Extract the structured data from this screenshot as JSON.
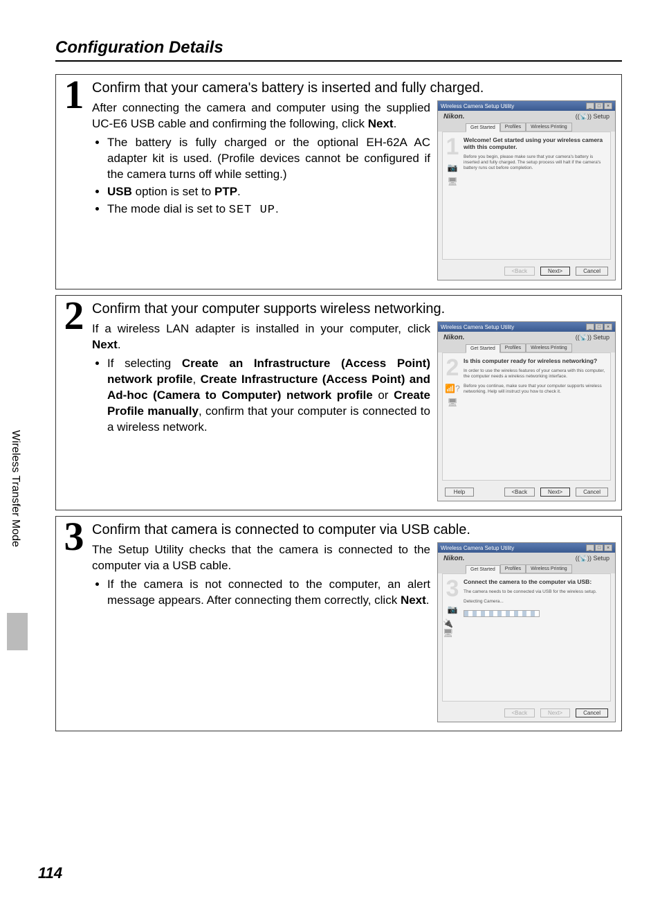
{
  "sectionTitle": "Configuration Details",
  "sideTab": "Wireless Transfer Mode",
  "pageNumber": "114",
  "steps": [
    {
      "num": "1",
      "title": "Confirm that your camera's battery is inserted and fully charged.",
      "intro_a": "After connecting the camera and computer using the supplied UC-E6 USB cable and confirming the following, click ",
      "intro_next": "Next",
      "intro_b": ".",
      "b1": "The battery is fully charged or the optional EH-62A AC adapter kit is used. (Profile devices cannot be configured if the camera turns off while setting.)",
      "b2_a": "USB",
      "b2_b": " option is set to ",
      "b2_c": "PTP",
      "b2_d": ".",
      "b3_a": "The mode dial is set to ",
      "b3_b": "SET UP",
      "b3_c": "."
    },
    {
      "num": "2",
      "title": "Confirm that your computer supports wireless networking.",
      "intro_a": "If a wireless LAN adapter is installed in your computer, click ",
      "intro_next": "Next",
      "intro_b": ".",
      "b1_a": "If selecting ",
      "b1_b": "Create an Infrastructure (Access Point) network profile",
      "b1_c": ", ",
      "b1_d": "Create Infrastructure (Access Point) and Ad-hoc (Camera to Computer) network profile",
      "b1_e": " or ",
      "b1_f": "Create Profile manually",
      "b1_g": ", confirm that your computer is connected to a wireless network."
    },
    {
      "num": "3",
      "title": "Confirm that camera is connected to computer via USB cable.",
      "intro": "The Setup Utility checks that the camera is connected to the computer via a USB cable.",
      "b1_a": "If the camera is not connected to the computer, an alert message appears. After connecting them correctly, click ",
      "b1_b": "Next",
      "b1_c": "."
    }
  ],
  "win": {
    "title": "Wireless Camera Setup Utility",
    "brand": "Nikon.",
    "setupLabel": "Setup",
    "tabs": {
      "t1": "Get Started",
      "t2": "Profiles",
      "t3": "Wireless Printing"
    },
    "buttons": {
      "help": "Help",
      "back": "<Back",
      "next": "Next>",
      "cancel": "Cancel"
    },
    "s1": {
      "digit": "1",
      "h": "Welcome! Get started using your wireless camera with this computer.",
      "p": "Before you begin, please make sure that your camera's battery is inserted and fully charged. The setup process will halt if the camera's battery runs out before completion."
    },
    "s2": {
      "digit": "2",
      "h": "Is this computer ready for wireless networking?",
      "p1": "In order to use the wireless features of your camera with this computer, the computer needs a wireless networking interface.",
      "p2": "Before you continue, make sure that your computer supports wireless networking. Help will instruct you how to check it."
    },
    "s3": {
      "digit": "3",
      "h": "Connect the camera to the computer via USB:",
      "p": "The camera needs to be connected via USB for the wireless setup.",
      "detecting": "Detecting Camera..."
    }
  }
}
